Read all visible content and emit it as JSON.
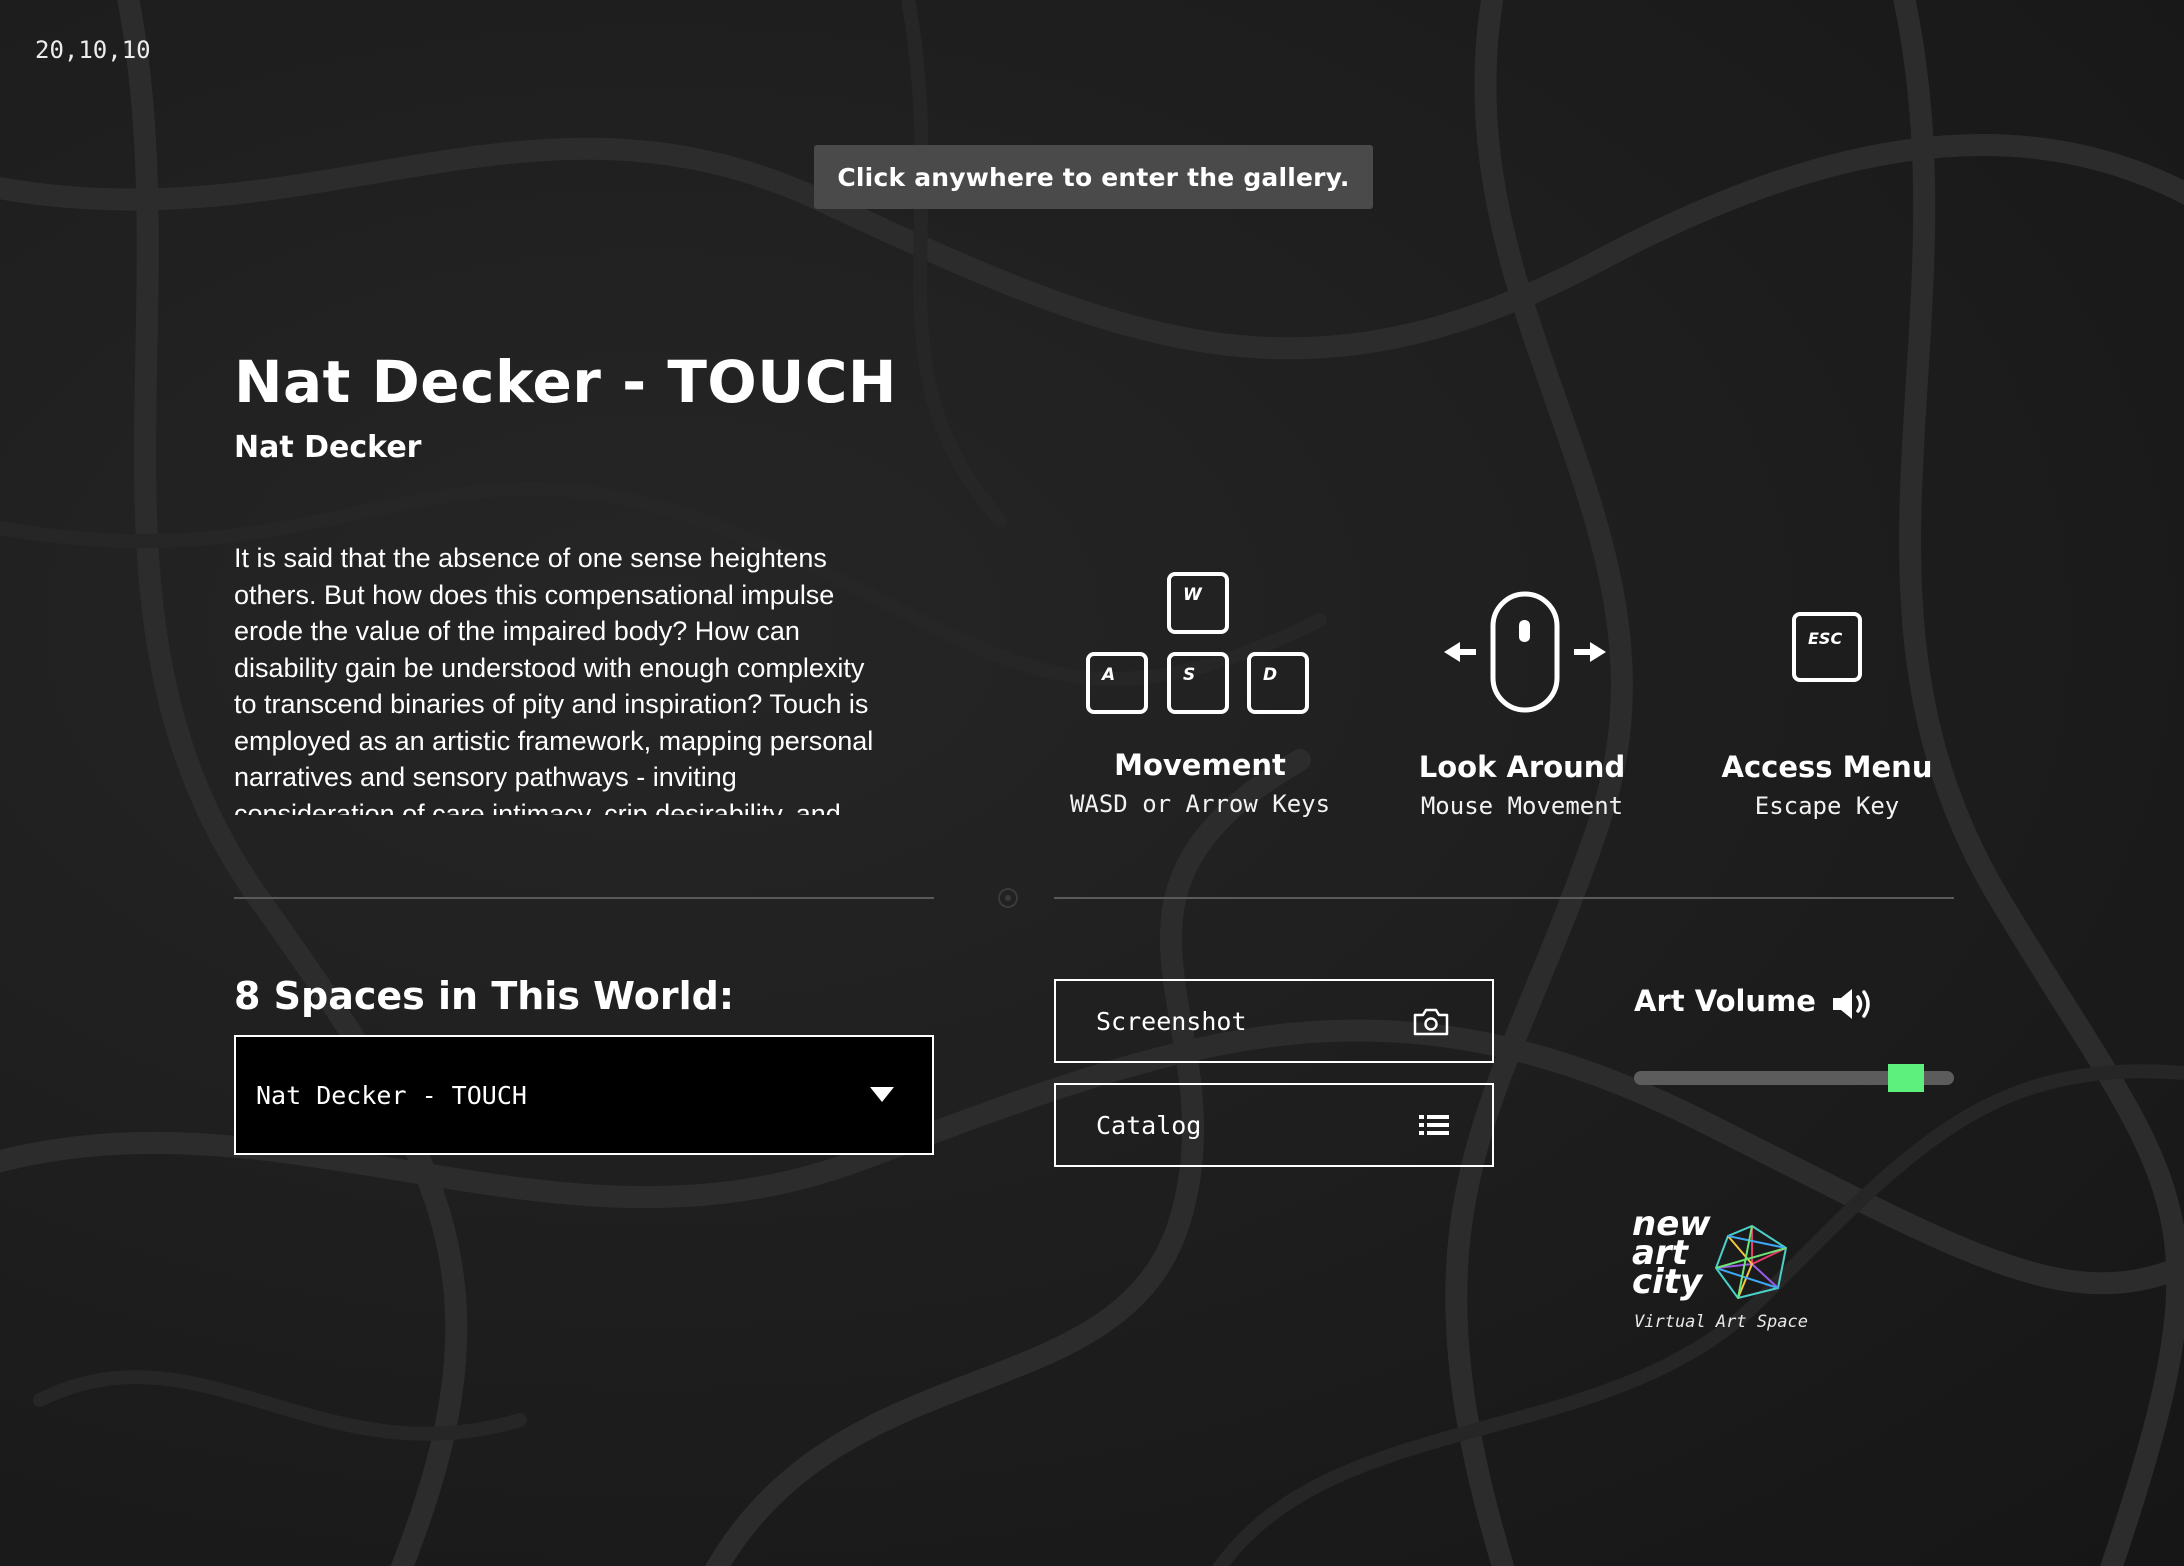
{
  "hud": {
    "coordinates": "20,10,10"
  },
  "banner": {
    "text": "Click anywhere to enter the gallery."
  },
  "exhibit": {
    "title": "Nat Decker - TOUCH",
    "artist": "Nat Decker",
    "description": "It is said that the absence of one sense heightens others. But how does this compensational impulse erode the value of the impaired body? How can disability gain be understood with enough complexity to transcend binaries of pity and inspiration? Touch is employed as an artistic framework, mapping personal narratives and sensory pathways - inviting consideration of care intimacy, crip desirability, and"
  },
  "controls": {
    "movement": {
      "title": "Movement",
      "subtitle": "WASD or Arrow Keys",
      "keys": {
        "w": "W",
        "a": "A",
        "s": "S",
        "d": "D"
      }
    },
    "look": {
      "title": "Look Around",
      "subtitle": "Mouse Movement"
    },
    "menu": {
      "title": "Access Menu",
      "subtitle": "Escape Key",
      "key": "ESC"
    }
  },
  "spaces": {
    "heading": "8 Spaces in This World:",
    "selected": "Nat Decker - TOUCH"
  },
  "actions": {
    "screenshot": {
      "label": "Screenshot",
      "icon": "camera-icon"
    },
    "catalog": {
      "label": "Catalog",
      "icon": "list-icon"
    }
  },
  "volume": {
    "label": "Art Volume",
    "level": 0.85,
    "icon": "speaker-icon",
    "thumb_color": "#5ef07c"
  },
  "logo": {
    "line1": "new",
    "line2": "art",
    "line3": "city",
    "tagline": "Virtual Art Space"
  }
}
